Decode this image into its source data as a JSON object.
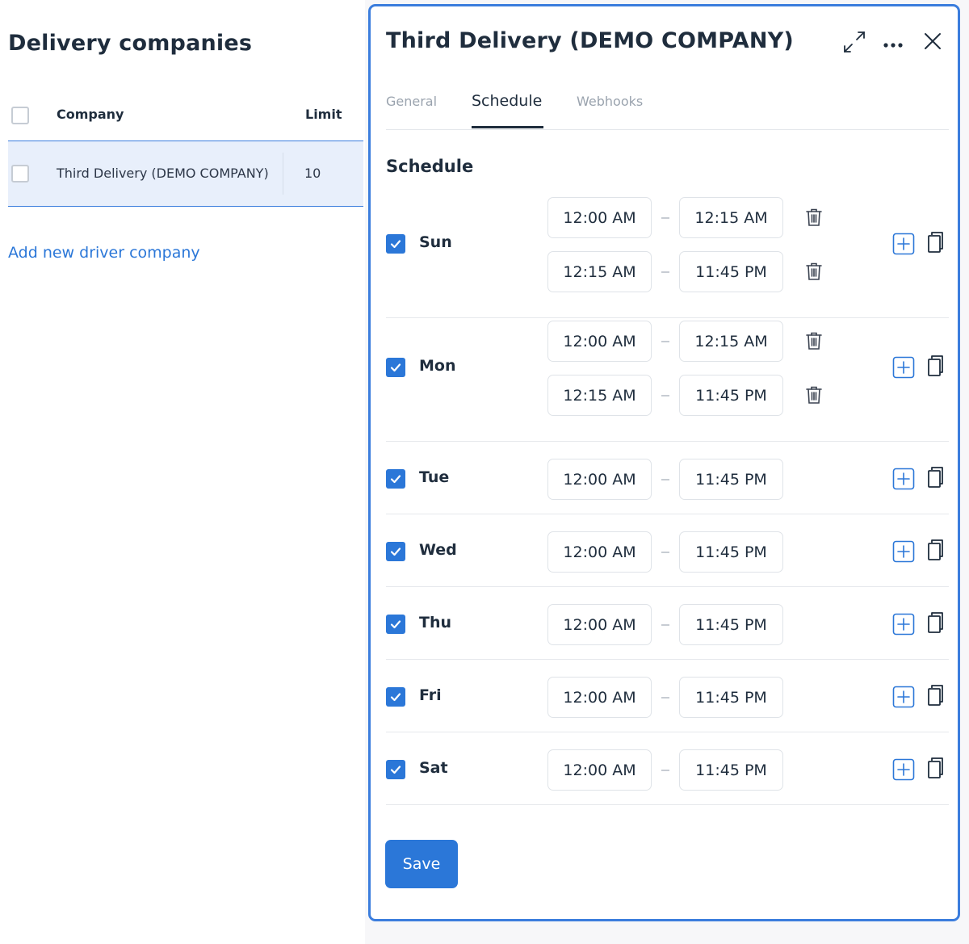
{
  "left": {
    "title": "Delivery companies",
    "columns": {
      "company": "Company",
      "limit": "Limit"
    },
    "rows": [
      {
        "company": "Third Delivery (DEMO COMPANY)",
        "limit": "10",
        "selected": true
      }
    ],
    "add_link": "Add new driver company"
  },
  "drawer": {
    "title": "Third Delivery (DEMO COMPANY)",
    "icons": [
      "expand-icon",
      "more-icon",
      "close-icon"
    ],
    "tabs": [
      {
        "label": "General",
        "active": false
      },
      {
        "label": "Schedule",
        "active": true
      },
      {
        "label": "Webhooks",
        "active": false
      }
    ],
    "section_title": "Schedule",
    "days": [
      {
        "label": "Sun",
        "checked": true,
        "ranges": [
          {
            "start": "12:00 AM",
            "end": "12:15 AM"
          },
          {
            "start": "12:15 AM",
            "end": "11:45 PM"
          }
        ]
      },
      {
        "label": "Mon",
        "checked": true,
        "ranges": [
          {
            "start": "12:00 AM",
            "end": "12:15 AM"
          },
          {
            "start": "12:15 AM",
            "end": "11:45 PM"
          }
        ]
      },
      {
        "label": "Tue",
        "checked": true,
        "ranges": [
          {
            "start": "12:00 AM",
            "end": "11:45 PM"
          }
        ]
      },
      {
        "label": "Wed",
        "checked": true,
        "ranges": [
          {
            "start": "12:00 AM",
            "end": "11:45 PM"
          }
        ]
      },
      {
        "label": "Thu",
        "checked": true,
        "ranges": [
          {
            "start": "12:00 AM",
            "end": "11:45 PM"
          }
        ]
      },
      {
        "label": "Fri",
        "checked": true,
        "ranges": [
          {
            "start": "12:00 AM",
            "end": "11:45 PM"
          }
        ]
      },
      {
        "label": "Sat",
        "checked": true,
        "ranges": [
          {
            "start": "12:00 AM",
            "end": "11:45 PM"
          }
        ]
      }
    ],
    "save_label": "Save"
  },
  "colors": {
    "accent": "#2b77d8",
    "selected_row": "#e8effb",
    "text": "#1f2d3d",
    "muted": "#9aa3ae"
  }
}
